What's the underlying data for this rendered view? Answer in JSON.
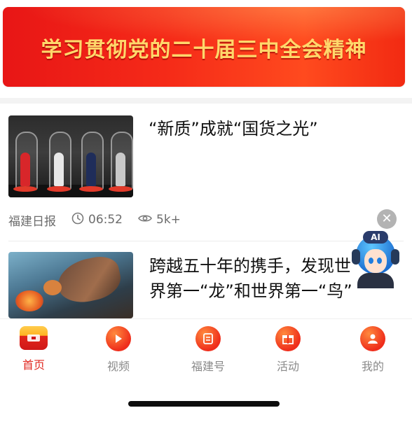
{
  "banner": {
    "title": "学习贯彻党的二十届三中全会精神"
  },
  "articles": [
    {
      "title": "“新质”成就“国货之光”",
      "source": "福建日报",
      "time": "06:52",
      "views": "5k+"
    },
    {
      "title": "跨越五十年的携手，发现世界第一“龙”和世界第一“鸟”"
    }
  ],
  "ai_assistant": {
    "badge": "AI"
  },
  "tabbar": {
    "tabs": [
      {
        "label": "首页",
        "active": true,
        "icon": "home-icon"
      },
      {
        "label": "视频",
        "active": false,
        "icon": "play-icon"
      },
      {
        "label": "福建号",
        "active": false,
        "icon": "scroll-icon"
      },
      {
        "label": "活动",
        "active": false,
        "icon": "gift-icon"
      },
      {
        "label": "我的",
        "active": false,
        "icon": "user-icon"
      }
    ]
  },
  "colors": {
    "accent": "#e02820",
    "banner_text": "#ffd86b",
    "meta_text": "#6c6c6c"
  }
}
